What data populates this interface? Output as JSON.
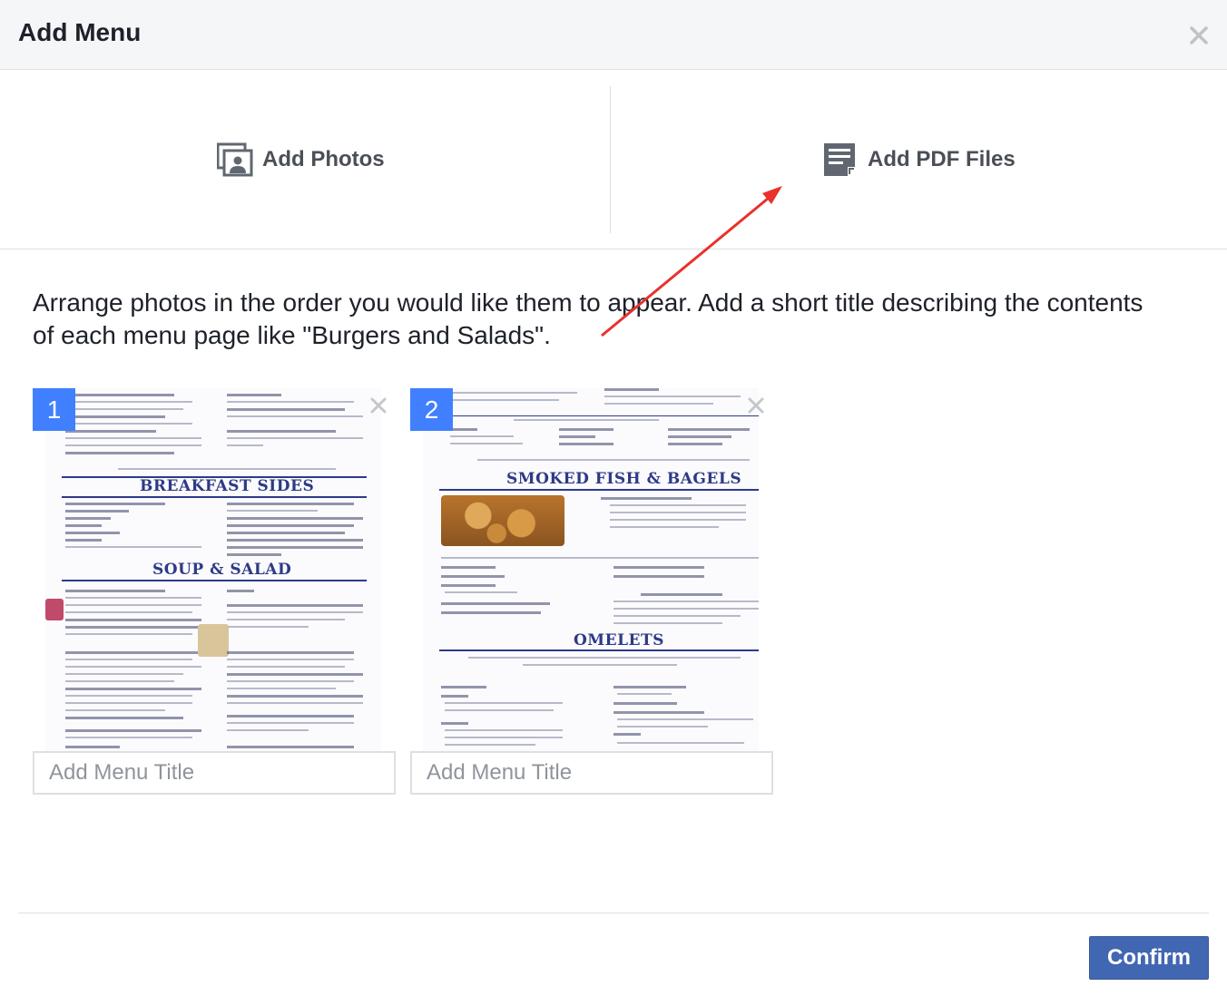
{
  "dialog": {
    "title": "Add Menu",
    "close_icon": "close-icon"
  },
  "options": {
    "photos": {
      "label": "Add Photos",
      "icon": "photos-icon"
    },
    "pdf": {
      "label": "Add PDF Files",
      "icon": "pdf-file-icon"
    }
  },
  "instructions": "Arrange photos in the order you would like them to appear. Add a short title describing the contents of each menu page like \"Burgers and Salads\".",
  "menu_pages": [
    {
      "number": "1",
      "title_placeholder": "Add Menu Title",
      "headings": [
        "BREAKFAST SIDES",
        "SOUP & SALAD"
      ]
    },
    {
      "number": "2",
      "title_placeholder": "Add Menu Title",
      "headings": [
        "SMOKED FISH & BAGELS",
        "OMELETS"
      ]
    }
  ],
  "footer": {
    "confirm_label": "Confirm"
  },
  "colors": {
    "accent": "#4267b2",
    "badge": "#4080ff",
    "annotation_arrow": "#e8322b"
  }
}
